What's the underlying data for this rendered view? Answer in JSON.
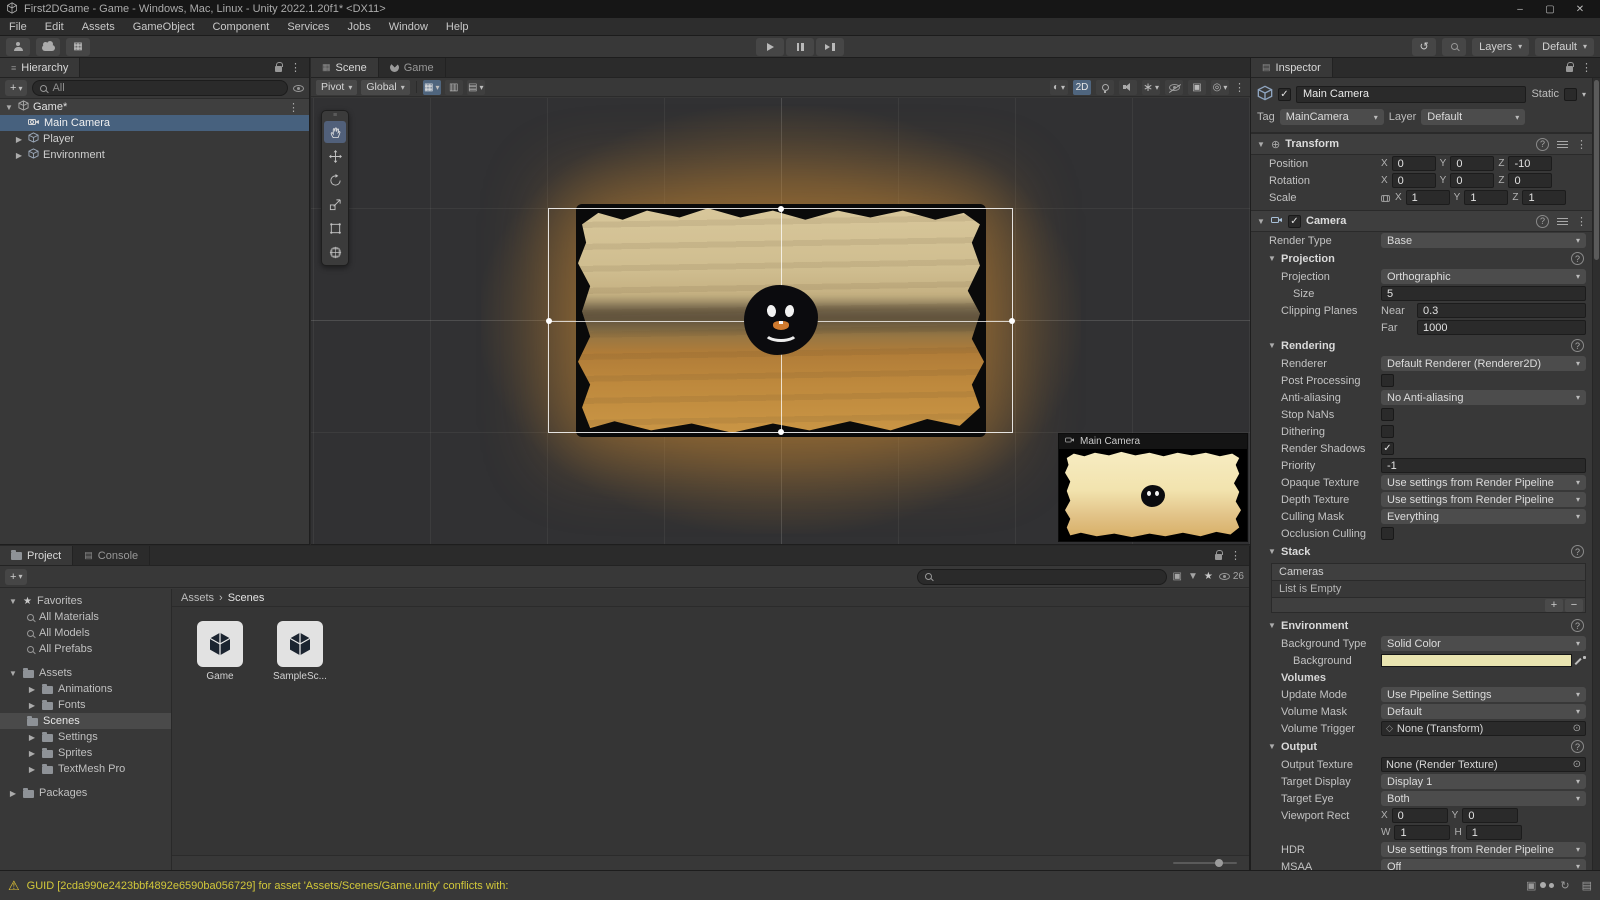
{
  "window": {
    "title": "First2DGame - Game - Windows, Mac, Linux - Unity 2022.1.20f1* <DX11>",
    "controls": {
      "minimize": "–",
      "maximize": "▢",
      "close": "✕"
    }
  },
  "menu": {
    "items": [
      "File",
      "Edit",
      "Assets",
      "GameObject",
      "Component",
      "Services",
      "Jobs",
      "Window",
      "Help"
    ]
  },
  "toolbar": {
    "layers": "Layers",
    "layout": "Default"
  },
  "hierarchy": {
    "tab": "Hierarchy",
    "search_placeholder": "All",
    "scene_name": "Game*",
    "items": [
      {
        "label": "Main Camera"
      },
      {
        "label": "Player"
      },
      {
        "label": "Environment"
      }
    ]
  },
  "scene": {
    "tabs": {
      "scene": "Scene",
      "game": "Game"
    },
    "toolbar": {
      "pivot": "Pivot",
      "global": "Global",
      "mode_2d": "2D"
    },
    "camera_preview": {
      "title": "Main Camera"
    }
  },
  "project": {
    "tabs": {
      "project": "Project",
      "console": "Console"
    },
    "hidden_count": "26",
    "tree": {
      "favorites_label": "Favorites",
      "favorites": [
        "All Materials",
        "All Models",
        "All Prefabs"
      ],
      "assets_label": "Assets",
      "folders": [
        "Animations",
        "Fonts",
        "Scenes",
        "Settings",
        "Sprites",
        "TextMesh Pro"
      ],
      "packages_label": "Packages"
    },
    "breadcrumb": {
      "root": "Assets",
      "separator": "›",
      "current": "Scenes"
    },
    "files": [
      {
        "name": "Game"
      },
      {
        "name": "SampleSc..."
      }
    ]
  },
  "inspector": {
    "tab": "Inspector",
    "header": {
      "enabled": true,
      "name": "Main Camera",
      "static_label": "Static",
      "tag_label": "Tag",
      "tag_value": "MainCamera",
      "layer_label": "Layer",
      "layer_value": "Default"
    },
    "axes": {
      "x": "X",
      "y": "Y",
      "z": "Z"
    },
    "transform": {
      "title": "Transform",
      "position": {
        "label": "Position",
        "x": "0",
        "y": "0",
        "z": "-10"
      },
      "rotation": {
        "label": "Rotation",
        "x": "0",
        "y": "0",
        "z": "0"
      },
      "scale": {
        "label": "Scale",
        "x": "1",
        "y": "1",
        "z": "1"
      }
    },
    "camera": {
      "title": "Camera",
      "enabled": true,
      "render_type": {
        "label": "Render Type",
        "value": "Base"
      },
      "projection": {
        "title": "Projection",
        "projection": {
          "label": "Projection",
          "value": "Orthographic"
        },
        "size": {
          "label": "Size",
          "value": "5"
        },
        "clipping": {
          "label": "Clipping Planes",
          "near_label": "Near",
          "near": "0.3",
          "far_label": "Far",
          "far": "1000"
        }
      },
      "rendering": {
        "title": "Rendering",
        "renderer": {
          "label": "Renderer",
          "value": "Default Renderer (Renderer2D)"
        },
        "post_processing": {
          "label": "Post Processing",
          "checked": false
        },
        "anti_aliasing": {
          "label": "Anti-aliasing",
          "value": "No Anti-aliasing"
        },
        "stop_nans": {
          "label": "Stop NaNs",
          "checked": false
        },
        "dithering": {
          "label": "Dithering",
          "checked": false
        },
        "render_shadows": {
          "label": "Render Shadows",
          "checked": true
        },
        "priority": {
          "label": "Priority",
          "value": "-1"
        },
        "opaque_texture": {
          "label": "Opaque Texture",
          "value": "Use settings from Render Pipeline"
        },
        "depth_texture": {
          "label": "Depth Texture",
          "value": "Use settings from Render Pipeline"
        },
        "culling_mask": {
          "label": "Culling Mask",
          "value": "Everything"
        },
        "occlusion_culling": {
          "label": "Occlusion Culling",
          "checked": false
        }
      },
      "stack": {
        "title": "Stack",
        "cameras_label": "Cameras",
        "empty_text": "List is Empty"
      },
      "environment": {
        "title": "Environment",
        "background_type": {
          "label": "Background Type",
          "value": "Solid Color"
        },
        "background": {
          "label": "Background",
          "color": "#E9E4B0"
        },
        "volumes_label": "Volumes",
        "update_mode": {
          "label": "Update Mode",
          "value": "Use Pipeline Settings"
        },
        "volume_mask": {
          "label": "Volume Mask",
          "value": "Default"
        },
        "volume_trigger": {
          "label": "Volume Trigger",
          "value": "None (Transform)"
        }
      },
      "output": {
        "title": "Output",
        "output_texture": {
          "label": "Output Texture",
          "value": "None (Render Texture)"
        },
        "target_display": {
          "label": "Target Display",
          "value": "Display 1"
        },
        "target_eye": {
          "label": "Target Eye",
          "value": "Both"
        },
        "viewport_rect": {
          "label": "Viewport Rect",
          "x_label": "X",
          "x": "0",
          "y_label": "Y",
          "y": "0",
          "w_label": "W",
          "w": "1",
          "h_label": "H",
          "h": "1"
        },
        "hdr": {
          "label": "HDR",
          "value": "Use settings from Render Pipeline"
        },
        "msaa": {
          "label": "MSAA",
          "value": "Off"
        }
      }
    }
  },
  "status": {
    "warning": "GUID [2cda990e2423bbf4892e6590ba056729] for asset 'Assets/Scenes/Game.unity' conflicts with:"
  },
  "colors": {
    "selection": "#47617E",
    "glow": "#D89437",
    "warning_text": "#D2C83A"
  }
}
